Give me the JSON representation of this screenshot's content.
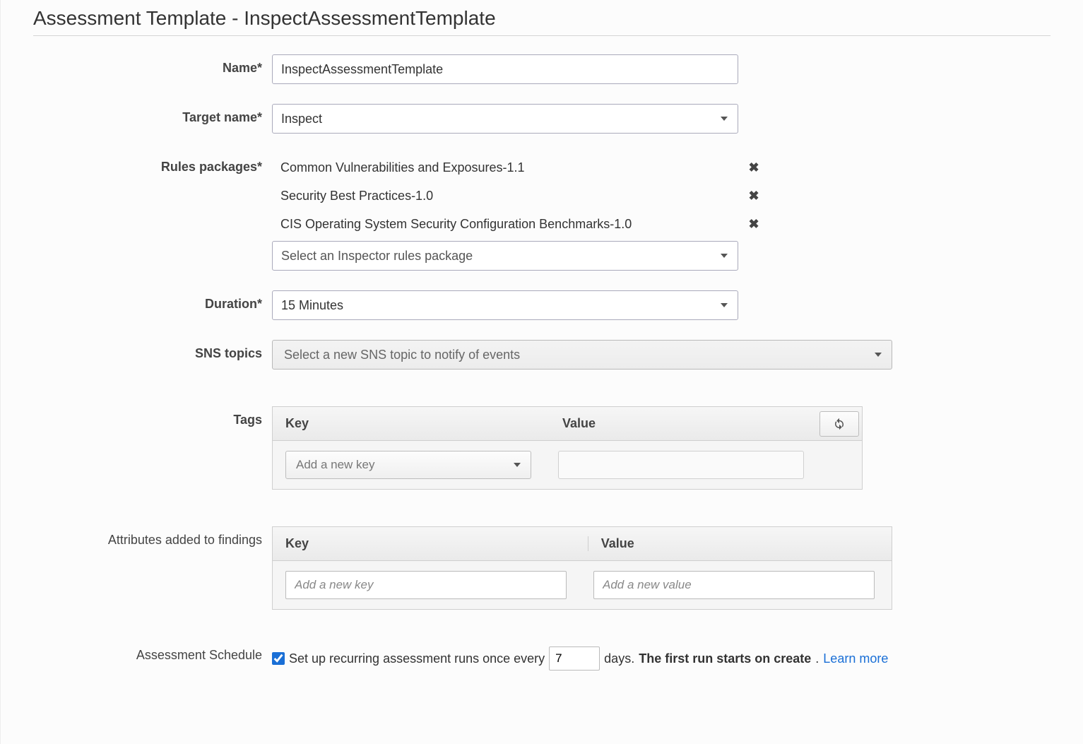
{
  "page_title": "Assessment Template - InspectAssessmentTemplate",
  "labels": {
    "name": "Name*",
    "target_name": "Target name*",
    "rules_packages": "Rules packages*",
    "duration": "Duration*",
    "sns_topics": "SNS topics",
    "tags": "Tags",
    "attributes": "Attributes added to findings",
    "schedule": "Assessment Schedule"
  },
  "fields": {
    "name_value": "InspectAssessmentTemplate",
    "target_name_value": "Inspect",
    "duration_value": "15 Minutes",
    "sns_placeholder": "Select a new SNS topic to notify of events",
    "rules_placeholder": "Select an Inspector rules package",
    "rules_items": [
      "Common Vulnerabilities and Exposures-1.1",
      "Security Best Practices-1.0",
      "CIS Operating System Security Configuration Benchmarks-1.0"
    ]
  },
  "tags_table": {
    "header_key": "Key",
    "header_value": "Value",
    "add_key_placeholder": "Add a new key",
    "add_value_placeholder": ""
  },
  "attrs_table": {
    "header_key": "Key",
    "header_value": "Value",
    "key_placeholder": "Add a new key",
    "value_placeholder": "Add a new value"
  },
  "schedule": {
    "checked": true,
    "text_before": "Set up recurring assessment runs once every",
    "interval_days": "7",
    "text_after": "days.",
    "bold_text": "The first run starts on create",
    "dot": ".",
    "learn_more": "Learn more"
  },
  "icons": {
    "remove": "✖",
    "refresh": "↻"
  }
}
